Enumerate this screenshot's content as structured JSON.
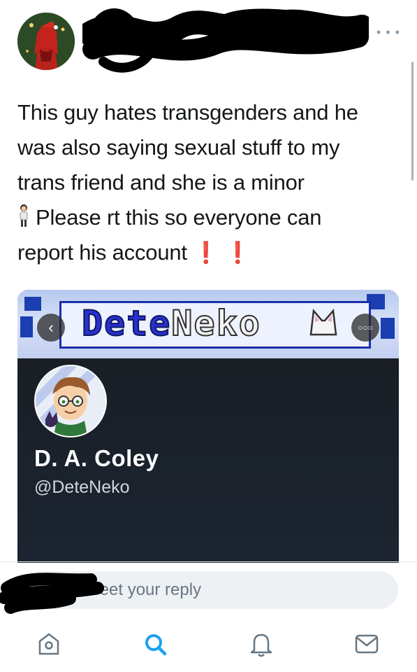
{
  "header": {
    "more_icon": "more-horizontal-icon"
  },
  "tweet": {
    "lines": [
      "This guy hates transgenders and he",
      "was also saying sexual stuff to my",
      "trans friend and she is a minor",
      "Please rt this so everyone can",
      "report his account"
    ],
    "exclamation": "❗",
    "emoji": "woman-standing-emoji"
  },
  "card": {
    "banner_text_part1": "Dete",
    "banner_text_part2": "Neko",
    "display_name": "D. A. Coley",
    "handle": "@DeteNeko",
    "colors": {
      "banner_blue": "#2a2fd0",
      "card_bg": "#15202b"
    }
  },
  "reply": {
    "placeholder": "Tweet your reply"
  },
  "tabs": [
    {
      "name": "home",
      "icon": "home-icon"
    },
    {
      "name": "search",
      "icon": "search-icon"
    },
    {
      "name": "notifications",
      "icon": "bell-icon"
    },
    {
      "name": "messages",
      "icon": "mail-icon"
    }
  ],
  "colors": {
    "accent": "#1da1f2",
    "icon_gray": "#657786",
    "text": "#14171a"
  }
}
